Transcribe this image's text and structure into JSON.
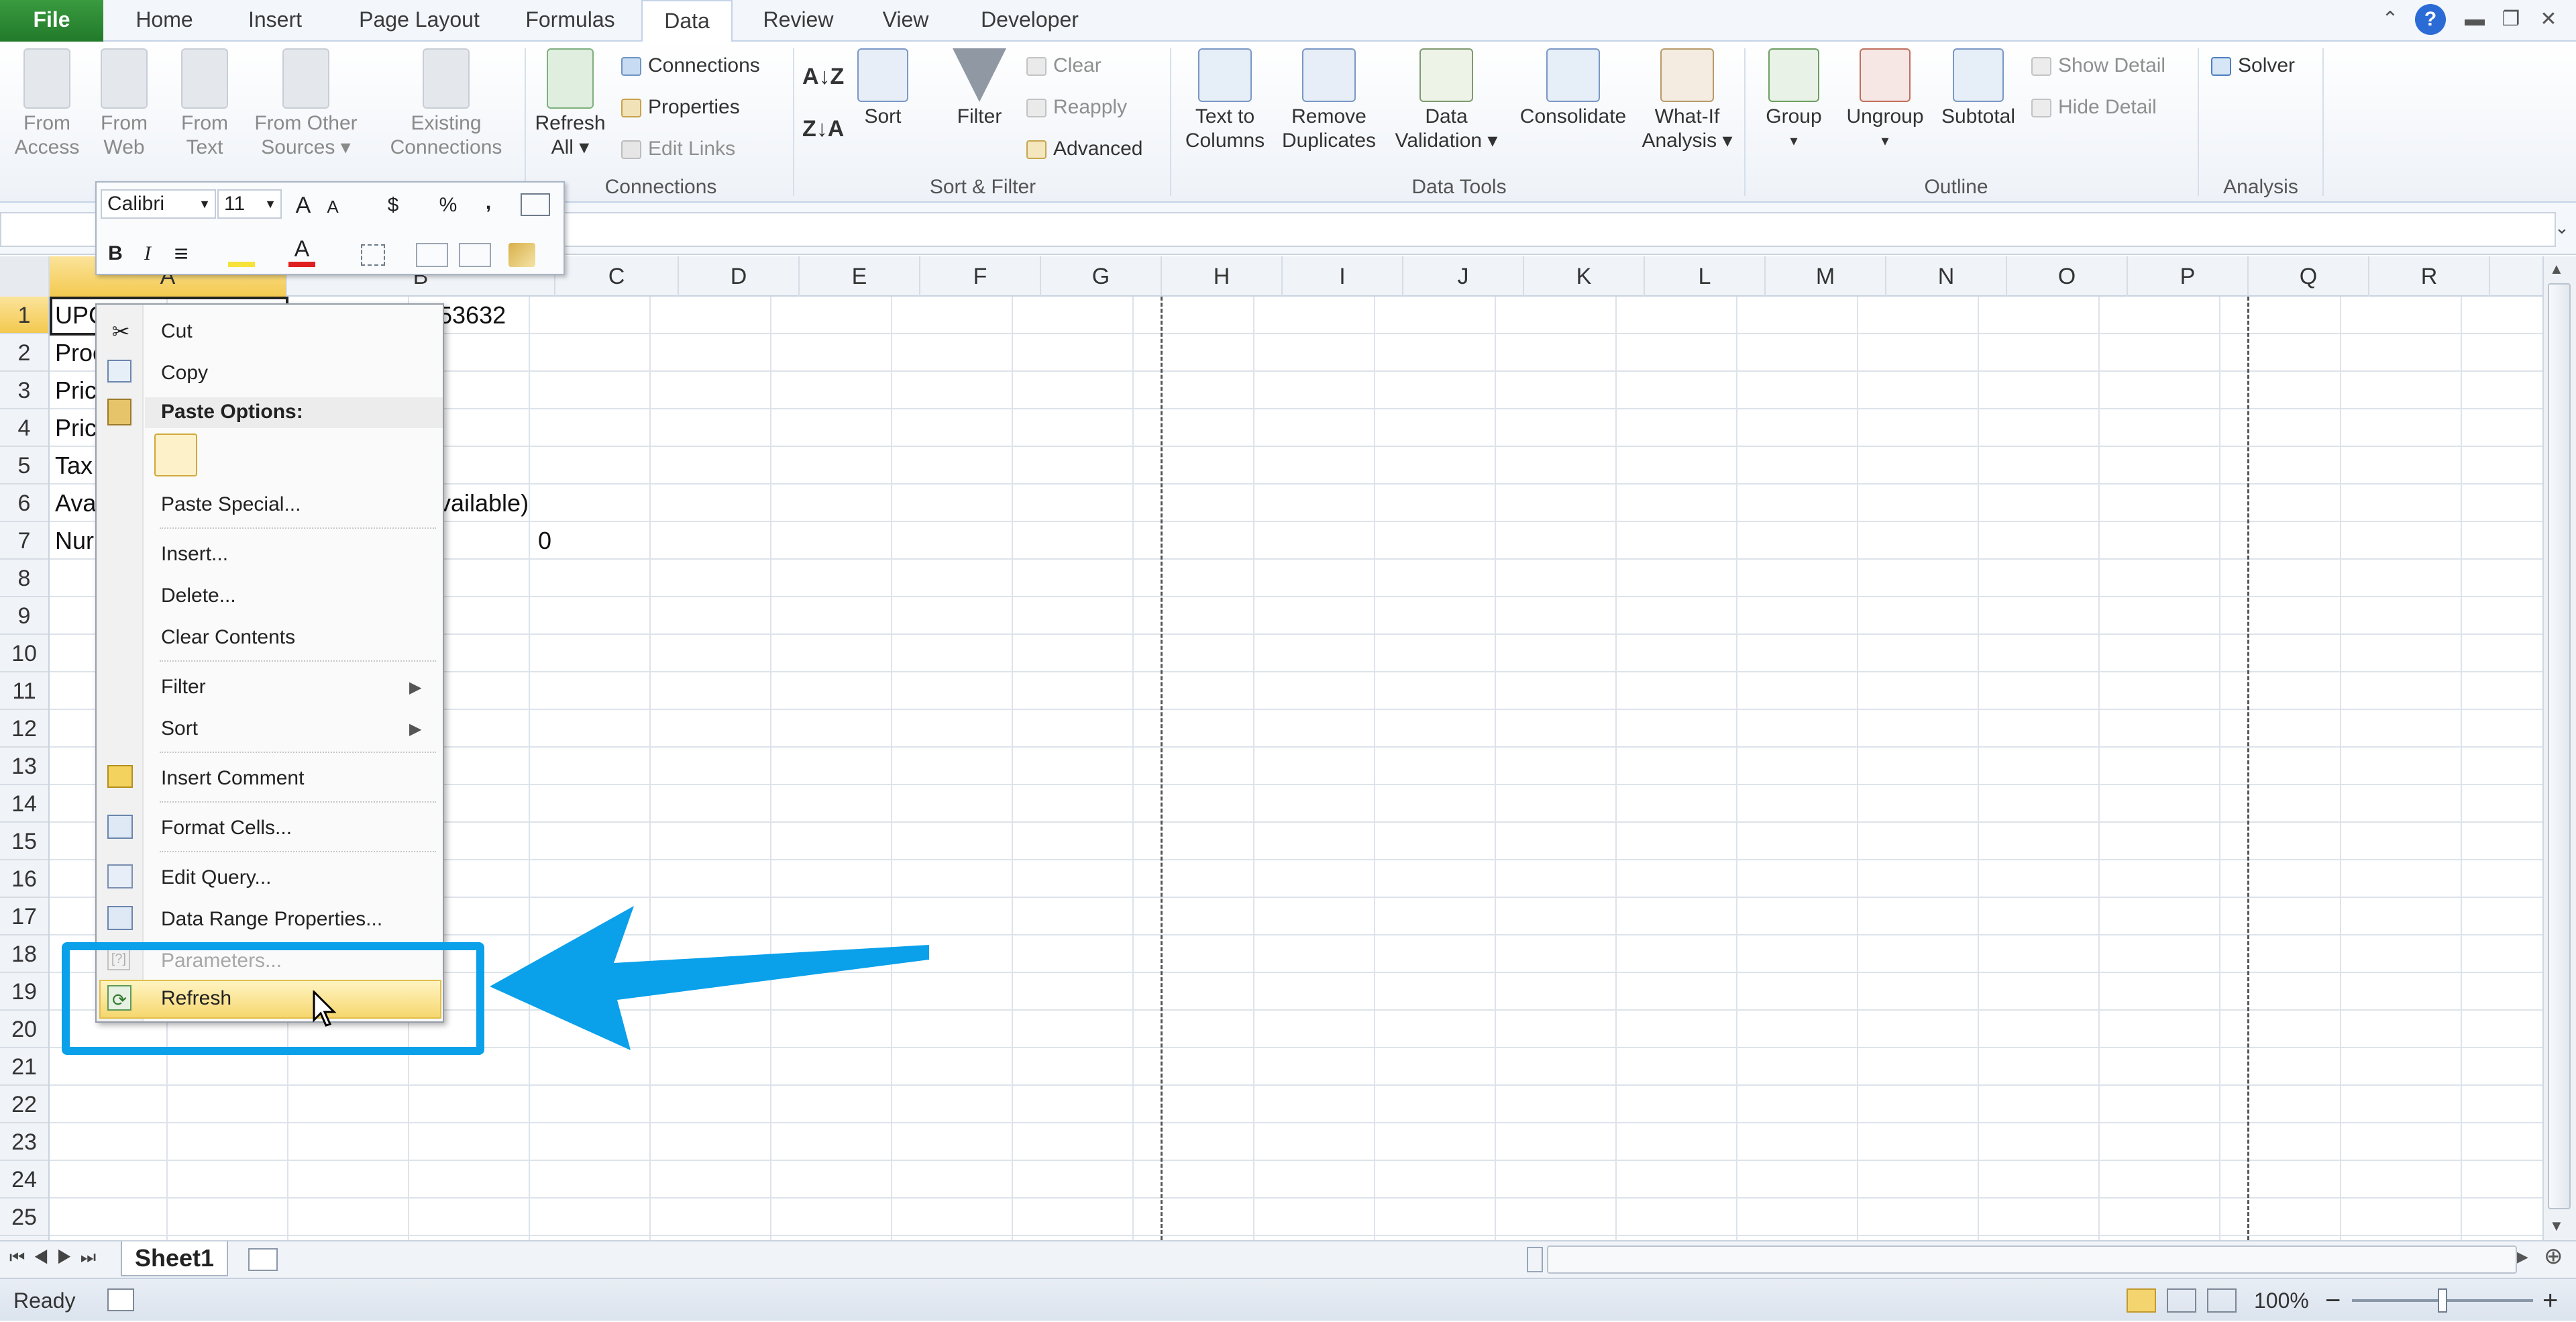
{
  "tabs": {
    "file": "File",
    "home": "Home",
    "insert": "Insert",
    "page_layout": "Page Layout",
    "formulas": "Formulas",
    "data": "Data",
    "review": "Review",
    "view": "View",
    "developer": "Developer"
  },
  "ribbon": {
    "from_access": [
      "From",
      "Access"
    ],
    "from_web": [
      "From",
      "Web"
    ],
    "from_text": [
      "From",
      "Text"
    ],
    "from_other": [
      "From Other",
      "Sources ▾"
    ],
    "existing": [
      "Existing",
      "Connections"
    ],
    "refresh_all": [
      "Refresh",
      "All ▾"
    ],
    "connections": "Connections",
    "properties": "Properties",
    "edit_links": "Edit Links",
    "connections_group": "Connections",
    "sort": "Sort",
    "filter": "Filter",
    "clear": "Clear",
    "reapply": "Reapply",
    "advanced": "Advanced",
    "sort_filter_group": "Sort & Filter",
    "text_to_columns": [
      "Text to",
      "Columns"
    ],
    "remove_duplicates": [
      "Remove",
      "Duplicates"
    ],
    "data_validation": [
      "Data",
      "Validation ▾"
    ],
    "consolidate": "Consolidate",
    "what_if": [
      "What-If",
      "Analysis ▾"
    ],
    "data_tools_group": "Data Tools",
    "group": [
      "Group",
      "▾"
    ],
    "ungroup": [
      "Ungroup",
      "▾"
    ],
    "subtotal": "Subtotal",
    "show_detail": "Show Detail",
    "hide_detail": "Hide Detail",
    "outline_group": "Outline",
    "solver": "Solver",
    "analysis_group": "Analysis"
  },
  "mini_toolbar": {
    "font": "Calibri",
    "size": "11",
    "grow": "A",
    "shrink": "A",
    "currency": "$",
    "percent": "%",
    "comma": ",",
    "bold": "B",
    "italic": "I",
    "center": "≡",
    "font_color": "A"
  },
  "columns": [
    "A",
    "B",
    "C",
    "D",
    "E",
    "F",
    "G",
    "H",
    "I",
    "J",
    "K",
    "L",
    "M",
    "N",
    "O",
    "P",
    "Q",
    "R"
  ],
  "rows": [
    "1",
    "2",
    "3",
    "4",
    "5",
    "6",
    "7",
    "8",
    "9",
    "10",
    "11",
    "12",
    "13",
    "14",
    "15",
    "16",
    "17",
    "18",
    "19",
    "20",
    "21",
    "22",
    "23",
    "24",
    "25"
  ],
  "cells": {
    "a1": "UPC",
    "b1": "53632",
    "a2": "Proc",
    "a3": "Pric",
    "a4": "Pric",
    "a5": "Tax",
    "a6": "Ava",
    "b6": "vailable)",
    "a7": "Nur",
    "b7": "0"
  },
  "context_menu": {
    "cut": "Cut",
    "copy": "Copy",
    "paste_options": "Paste Options:",
    "paste_special": "Paste Special...",
    "insert": "Insert...",
    "delete": "Delete...",
    "clear_contents": "Clear Contents",
    "filter": "Filter",
    "sort": "Sort",
    "insert_comment": "Insert Comment",
    "format_cells": "Format Cells...",
    "edit_query": "Edit Query...",
    "data_range_properties": "Data Range Properties...",
    "parameters": "Parameters...",
    "refresh": "Refresh"
  },
  "sheet": {
    "tab": "Sheet1"
  },
  "status": {
    "ready": "Ready",
    "zoom": "100%",
    "zoom_minus": "−",
    "zoom_plus": "+"
  },
  "colors": {
    "accent_blue": "#0aa0ea",
    "file_green": "#217a2a",
    "selection_gold": "#f3c94f"
  }
}
